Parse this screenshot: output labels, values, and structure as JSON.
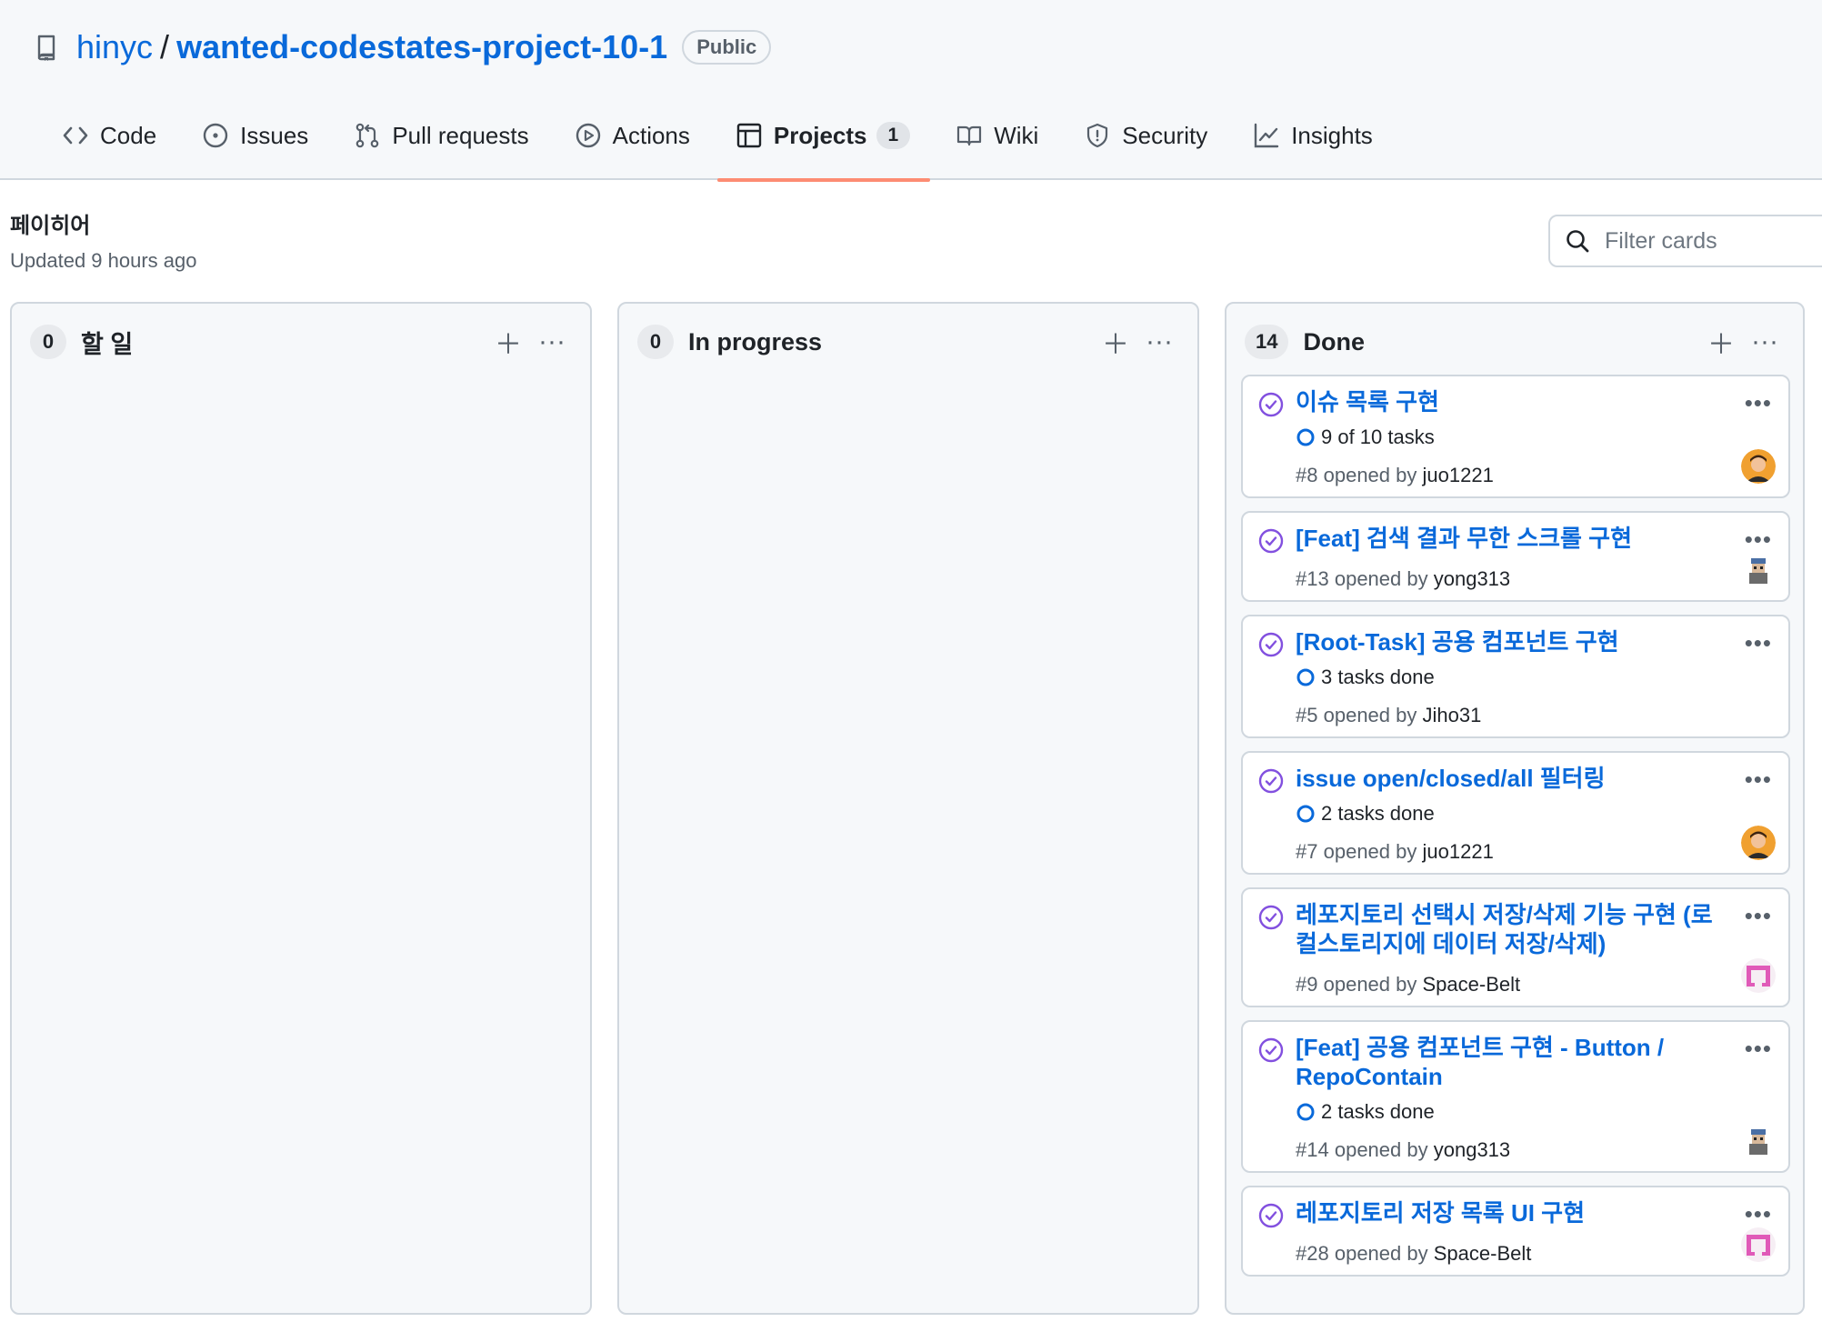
{
  "repo": {
    "owner": "hinyc",
    "slash": "/",
    "name": "wanted-codestates-project-10-1",
    "visibility": "Public"
  },
  "tabs": [
    {
      "label": "Code",
      "icon": "code-icon"
    },
    {
      "label": "Issues",
      "icon": "issue-icon"
    },
    {
      "label": "Pull requests",
      "icon": "pull-request-icon"
    },
    {
      "label": "Actions",
      "icon": "play-icon"
    },
    {
      "label": "Projects",
      "icon": "table-icon",
      "count": "1",
      "active": true
    },
    {
      "label": "Wiki",
      "icon": "book-icon"
    },
    {
      "label": "Security",
      "icon": "shield-icon"
    },
    {
      "label": "Insights",
      "icon": "graph-icon"
    }
  ],
  "board": {
    "title": "페이히어",
    "updated": "Updated 9 hours ago"
  },
  "filter": {
    "placeholder": "Filter cards"
  },
  "columns": [
    {
      "count": "0",
      "name": "할 일",
      "cards": []
    },
    {
      "count": "0",
      "name": "In progress",
      "cards": []
    },
    {
      "count": "14",
      "name": "Done",
      "cards": [
        {
          "title": "이슈 목록 구현",
          "tasks": "9 of 10 tasks",
          "number": "#8",
          "opened": "opened by",
          "author": "juo1221",
          "avatar": "avatar-orange"
        },
        {
          "title": "[Feat] 검색 결과 무한 스크롤 구현",
          "number": "#13",
          "opened": "opened by",
          "author": "yong313",
          "avatar": "avatar-pixel"
        },
        {
          "title": "[Root-Task] 공용 컴포넌트 구현",
          "tasks": "3 tasks done",
          "number": "#5",
          "opened": "opened by",
          "author": "Jiho31",
          "avatar": ""
        },
        {
          "title": "issue open/closed/all 필터링",
          "tasks": "2 tasks done",
          "number": "#7",
          "opened": "opened by",
          "author": "juo1221",
          "avatar": "avatar-orange"
        },
        {
          "title": "레포지토리 선택시 저장/삭제 기능 구현 (로컬스토리지에 데이터 저장/삭제)",
          "number": "#9",
          "opened": "opened by",
          "author": "Space-Belt",
          "avatar": "avatar-pink"
        },
        {
          "title": "[Feat] 공용 컴포넌트 구현 - Button / RepoContain",
          "tasks": "2 tasks done",
          "number": "#14",
          "opened": "opened by",
          "author": "yong313",
          "avatar": "avatar-pixel"
        },
        {
          "title": "레포지토리 저장 목록 UI 구현",
          "number": "#28",
          "opened": "opened by",
          "author": "Space-Belt",
          "avatar": "avatar-pink"
        }
      ]
    }
  ],
  "colors": {
    "link": "#0969da",
    "closed": "#8250df",
    "underline": "#fd8c73"
  }
}
